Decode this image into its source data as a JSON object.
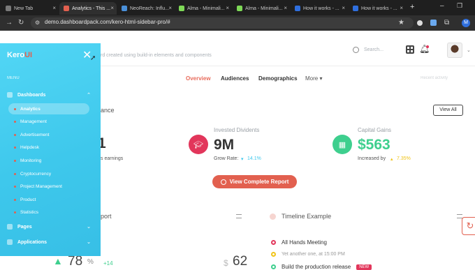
{
  "browser": {
    "tabs": [
      {
        "label": "New Tab",
        "favicon_color": "#7a7a7a"
      },
      {
        "label": "Analytics - This ...",
        "favicon_color": "#e2604f"
      },
      {
        "label": "NeoReach: Influ...",
        "favicon_color": "#4a90d9"
      },
      {
        "label": "Alma - Minimali...",
        "favicon_color": "#7ed957"
      },
      {
        "label": "Alma - Minimali...",
        "favicon_color": "#7ed957"
      },
      {
        "label": "How it works - ...",
        "favicon_color": "#2f6fde"
      },
      {
        "label": "How it works - ...",
        "favicon_color": "#2f6fde"
      }
    ],
    "new_tab_icon": "+",
    "url": "demo.dashboardpack.com/kero-html-sidebar-pro/#",
    "profile_initial": "M"
  },
  "header": {
    "subtitle": "rd created using build-in elements and components",
    "search_placeholder": "Search..."
  },
  "nav_tabs": [
    {
      "label": "Overview",
      "active": true
    },
    {
      "label": "Audiences",
      "active": false
    },
    {
      "label": "Demographics",
      "active": false
    },
    {
      "label": "More",
      "active": false
    }
  ],
  "right_nav_hint": "Recent activity",
  "section": {
    "title_fragment": "ance",
    "view_all": "View All"
  },
  "metrics": [
    {
      "label": "",
      "value": "1",
      "sub": "s earnings"
    },
    {
      "label": "Invested Dividents",
      "value": "9M",
      "sub_label": "Grow Rate:",
      "sub_value": "14.1%",
      "accent": "#e2365b"
    },
    {
      "label": "Capital Gains",
      "value": "$563",
      "sub_label": "Increased by",
      "sub_value": "7.35%",
      "accent": "#3ecf8e"
    }
  ],
  "cta": {
    "label": "View Complete Report"
  },
  "lower_left": {
    "title_fragment": "port",
    "value_1": "78",
    "value_1_suffix": "%",
    "delta": "+14",
    "value_2": "62",
    "value_2_prefix": "$"
  },
  "timeline": {
    "title": "Timeline Example",
    "items": [
      {
        "text": "All Hands Meeting",
        "color": "#e2365b"
      },
      {
        "text": "Yet another one, at 15:00 PM",
        "color": "#f0c419"
      },
      {
        "text": "Build the production release",
        "color": "#3ecf8e",
        "badge": "NEW"
      }
    ]
  },
  "sidebar": {
    "brand_a": "Kero",
    "brand_b": "UI",
    "menu_label": "MENU",
    "group_dashboards": "Dashboards",
    "items": [
      {
        "label": "Analytics",
        "active": true
      },
      {
        "label": "Management",
        "active": false
      },
      {
        "label": "Advertisement",
        "active": false
      },
      {
        "label": "Helpdesk",
        "active": false
      },
      {
        "label": "Monitoring",
        "active": false
      },
      {
        "label": "Cryptocurrency",
        "active": false
      },
      {
        "label": "Project Management",
        "active": false
      },
      {
        "label": "Product",
        "active": false
      },
      {
        "label": "Statistics",
        "active": false
      }
    ],
    "group_pages": "Pages",
    "group_applications": "Applications"
  }
}
